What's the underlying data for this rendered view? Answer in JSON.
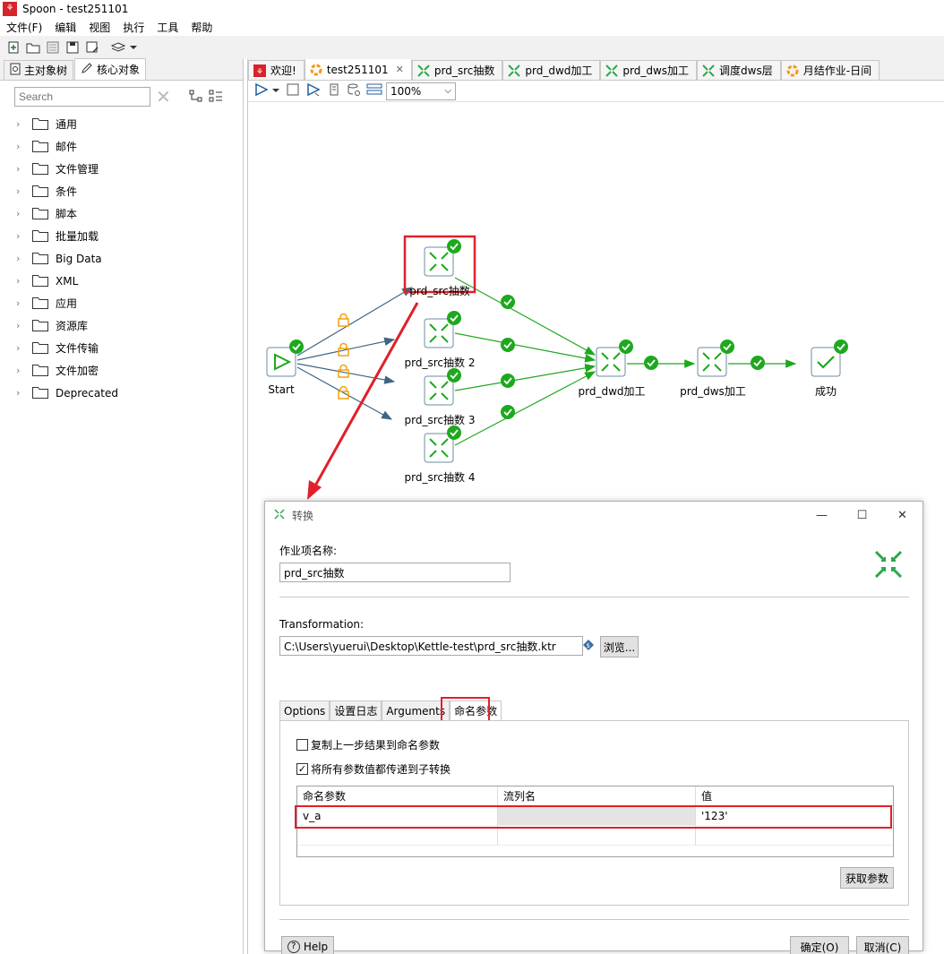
{
  "window": {
    "title": "Spoon - test251101"
  },
  "menu": [
    "文件(F)",
    "编辑",
    "视图",
    "执行",
    "工具",
    "帮助"
  ],
  "left_panel": {
    "tabs": [
      "主对象树",
      "核心对象"
    ],
    "search_placeholder": "Search",
    "folders": [
      "通用",
      "邮件",
      "文件管理",
      "条件",
      "脚本",
      "批量加载",
      "Big Data",
      "XML",
      "应用",
      "资源库",
      "文件传输",
      "文件加密",
      "Deprecated"
    ]
  },
  "editor_tabs": [
    {
      "label": "欢迎!",
      "icon": "spoon-icon"
    },
    {
      "label": "test251101",
      "icon": "job-icon",
      "active": true
    },
    {
      "label": "prd_src抽数",
      "icon": "transformation-icon"
    },
    {
      "label": "prd_dwd加工",
      "icon": "transformation-icon"
    },
    {
      "label": "prd_dws加工",
      "icon": "transformation-icon"
    },
    {
      "label": "调度dws层",
      "icon": "transformation-icon"
    },
    {
      "label": "月结作业-日间",
      "icon": "job-icon"
    }
  ],
  "zoom": "100%",
  "canvas": {
    "nodes": {
      "start": "Start",
      "src1": "prd_src抽数",
      "src2": "prd_src抽数 2",
      "src3": "prd_src抽数 3",
      "src4": "prd_src抽数 4",
      "dwd": "prd_dwd加工",
      "dws": "prd_dws加工",
      "success": "成功"
    }
  },
  "dialog": {
    "title": "转换",
    "job_entry_name_label": "作业项名称:",
    "job_entry_name": "prd_src抽数",
    "transformation_label": "Transformation:",
    "transformation_path": "C:\\Users\\yuerui\\Desktop\\Kettle-test\\prd_src抽数.ktr",
    "browse_label": "浏览...",
    "tabs": [
      "Options",
      "设置日志",
      "Arguments",
      "命名参数"
    ],
    "copy_results_label": "复制上一步结果到命名参数",
    "copy_results_checked": false,
    "pass_all_label": "将所有参数值都传递到子转换",
    "pass_all_checked": true,
    "columns": [
      "命名参数",
      "流列名",
      "值"
    ],
    "rows": [
      {
        "name": "v_a",
        "stream": "",
        "value": "'123'"
      }
    ],
    "get_params_label": "获取参数",
    "help_label": "Help",
    "ok_label": "确定(O)",
    "cancel_label": "取消(C)"
  }
}
